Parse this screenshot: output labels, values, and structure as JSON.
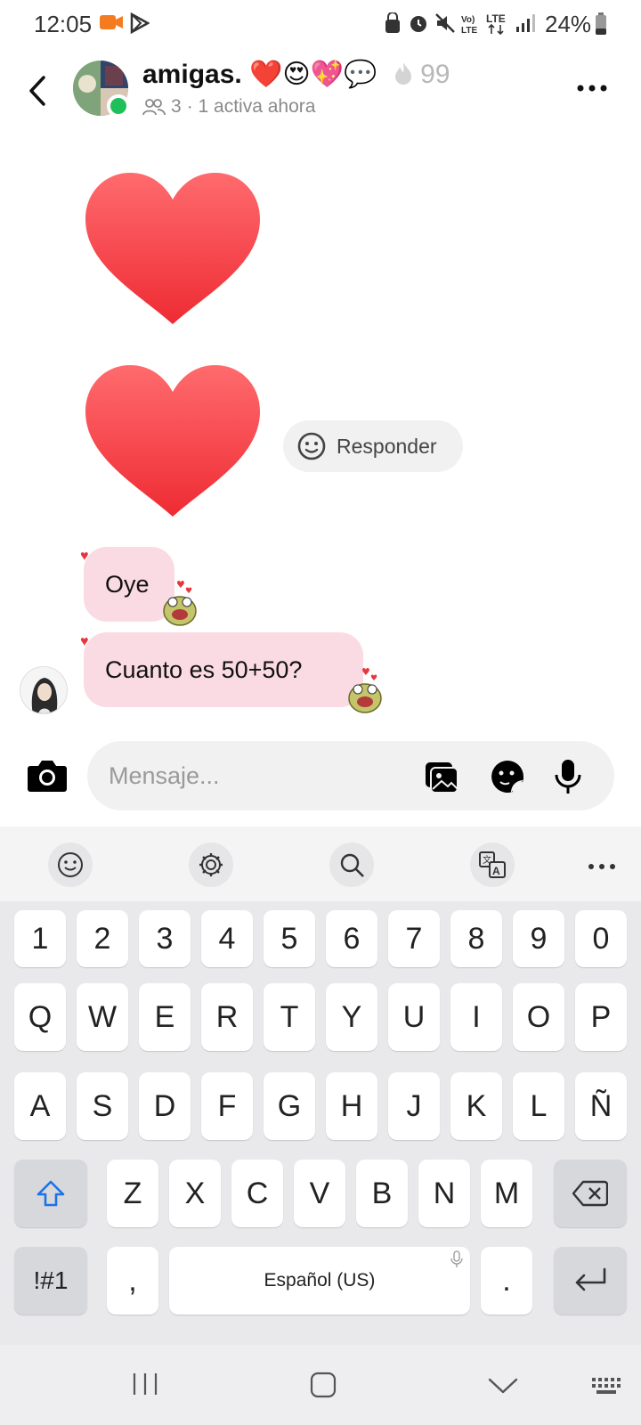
{
  "status_bar": {
    "time": "12:05",
    "battery": "24%"
  },
  "header": {
    "group_name": "amigas. ❤️😍💖💬",
    "streak": "99",
    "members": "3",
    "active": "· 1 activa ahora"
  },
  "messages": {
    "reply_label": "Responder",
    "msg1": "Oye",
    "msg2": "Cuanto  es 50+50?"
  },
  "composer": {
    "placeholder": "Mensaje..."
  },
  "keyboard": {
    "row_numbers": [
      "1",
      "2",
      "3",
      "4",
      "5",
      "6",
      "7",
      "8",
      "9",
      "0"
    ],
    "row1": [
      "Q",
      "W",
      "E",
      "R",
      "T",
      "Y",
      "U",
      "I",
      "O",
      "P"
    ],
    "row2": [
      "A",
      "S",
      "D",
      "F",
      "G",
      "H",
      "J",
      "K",
      "L",
      "Ñ"
    ],
    "row3": [
      "Z",
      "X",
      "C",
      "V",
      "B",
      "N",
      "M"
    ],
    "symbols_key": "!#1",
    "comma_key": ",",
    "space_label": "Español (US)",
    "period_key": "."
  },
  "colors": {
    "bubble": "#fbdbe3",
    "heart": "#f23b3f",
    "online": "#1fbf5a"
  }
}
